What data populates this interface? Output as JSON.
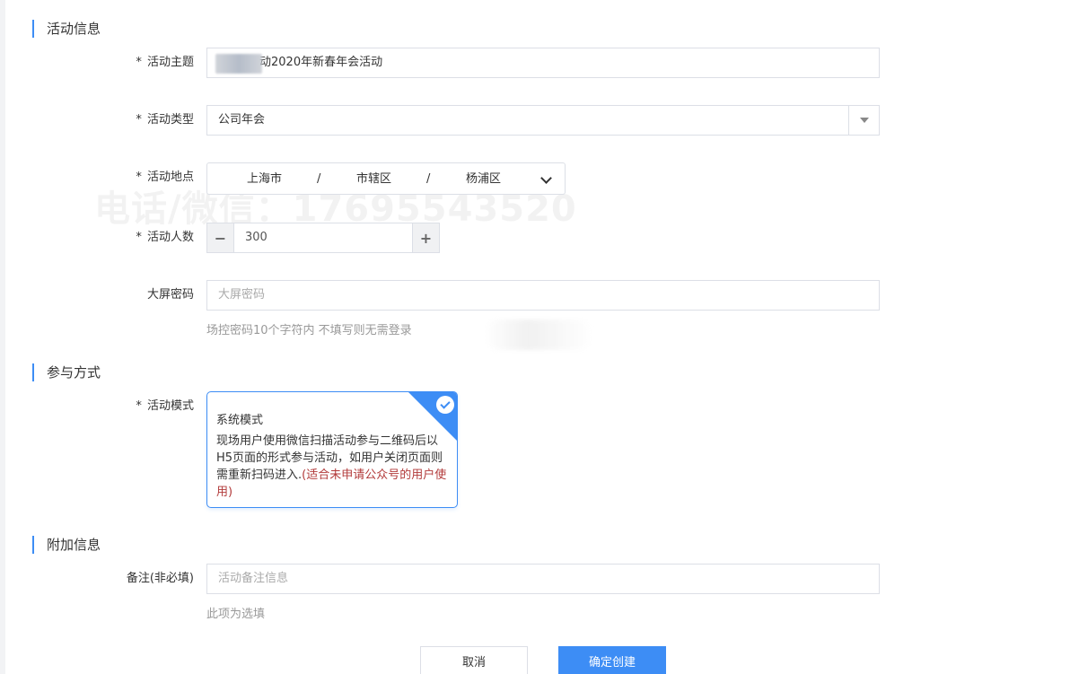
{
  "sections": {
    "activity_info": "活动信息",
    "participation": "参与方式",
    "extra_info": "附加信息"
  },
  "fields": {
    "theme": {
      "label": "活动主题",
      "value": "动2020年新春年会活动"
    },
    "type": {
      "label": "活动类型",
      "value": "公司年会"
    },
    "location": {
      "label": "活动地点",
      "province": "上海市",
      "city": "市辖区",
      "district": "杨浦区",
      "separator": "/"
    },
    "people": {
      "label": "活动人数",
      "value": "300",
      "minus": "−",
      "plus": "+"
    },
    "screen_password": {
      "label": "大屏密码",
      "placeholder": "大屏密码",
      "hint": "场控密码10个字符内 不填写则无需登录"
    },
    "mode": {
      "label": "活动模式",
      "card_title": "系统模式",
      "card_desc": "现场用户使用微信扫描活动参与二维码后以H5页面的形式参与活动，如用户关闭页面则需重新扫码进入.",
      "card_note": "(适合未申请公众号的用户使用)"
    },
    "remark": {
      "label": "备注(非必填)",
      "placeholder": "活动备注信息",
      "hint": "此项为选填"
    }
  },
  "required_mark": "*",
  "watermark": "电话/微信：17695543520",
  "buttons": {
    "cancel": "取消",
    "submit": "确定创建"
  },
  "colors": {
    "primary": "#3d8df5",
    "note_red": "#b23a3a",
    "border": "#dcdfe6"
  }
}
